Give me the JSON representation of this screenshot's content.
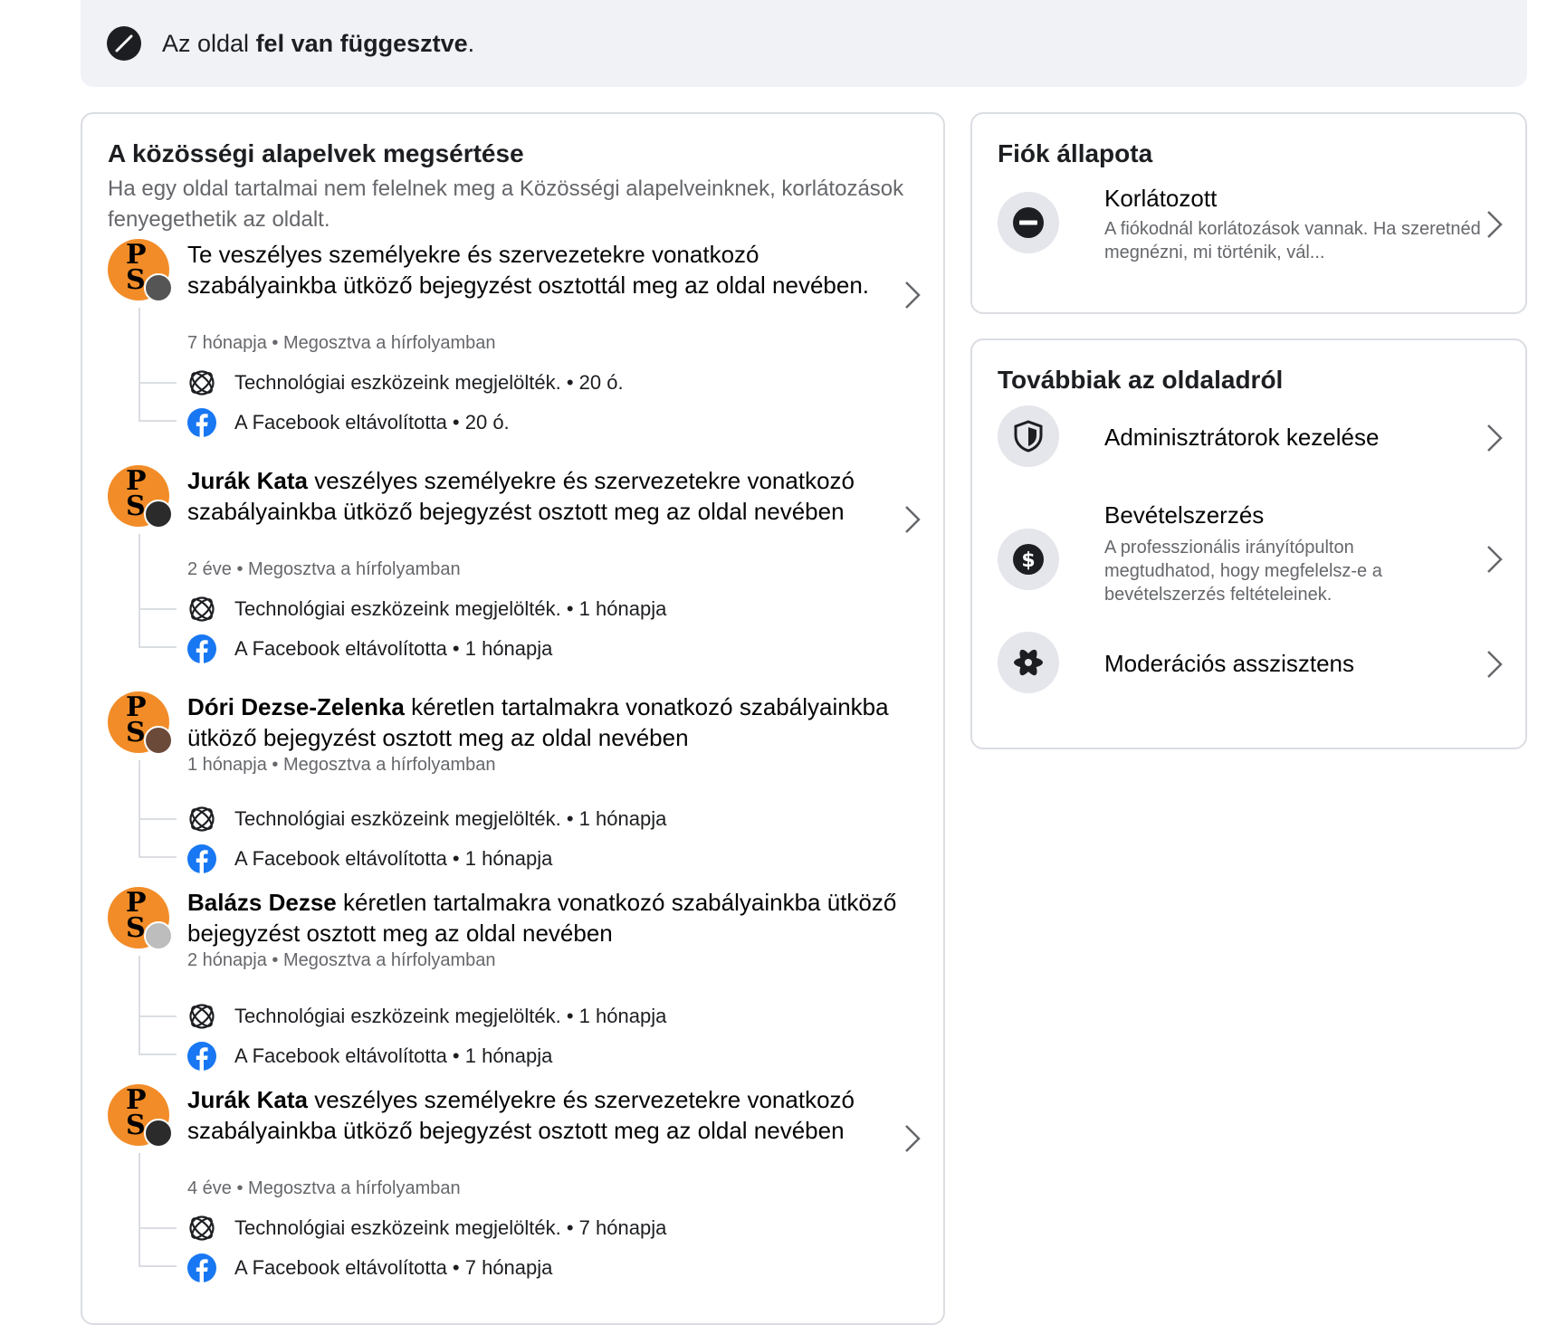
{
  "banner": {
    "text_pre": "Az oldal ",
    "text_bold": "fel van függesztve",
    "text_post": ".",
    "icon": "suspended-icon"
  },
  "violations_card": {
    "title": "A közösségi alapelvek megsértése",
    "subtitle": "Ha egy oldal tartalmai nem felelnek meg a Közösségi alapelveinknek, korlátozások fenyegethetik az oldalt.",
    "items": [
      {
        "author": "",
        "title_rest": "Te veszélyes személyekre és szervezetekre vonatkozó szabályainkba ütköző bejegyzést osztottál meg az oldal nevében.",
        "meta": "7 hónapja • Megosztva a hírfolyamban",
        "flagged": "Technológiai eszközeink megjelölték. • 20 ó.",
        "removed": "A Facebook eltávolította • 20 ó."
      },
      {
        "author": "Jurák Kata",
        "title_rest": " veszélyes személyekre és szervezetekre vonatkozó szabályainkba ütköző bejegyzést osztott meg az oldal nevében",
        "meta": "2 éve • Megosztva a hírfolyamban",
        "flagged": "Technológiai eszközeink megjelölték. • 1 hónapja",
        "removed": "A Facebook eltávolította • 1 hónapja"
      },
      {
        "author": "Dóri Dezse-Zelenka",
        "title_rest": " kéretlen tartalmakra vonatkozó szabályainkba ütköző bejegyzést osztott meg az oldal nevében",
        "meta": "1 hónapja • Megosztva a hírfolyamban",
        "flagged": "Technológiai eszközeink megjelölték. • 1 hónapja",
        "removed": "A Facebook eltávolította • 1 hónapja"
      },
      {
        "author": "Balázs Dezse",
        "title_rest": " kéretlen tartalmakra vonatkozó szabályainkba ütköző bejegyzést osztott meg az oldal nevében",
        "meta": "2 hónapja • Megosztva a hírfolyamban",
        "flagged": "Technológiai eszközeink megjelölték. • 1 hónapja",
        "removed": "A Facebook eltávolította • 1 hónapja"
      },
      {
        "author": "Jurák Kata",
        "title_rest": " veszélyes személyekre és szervezetekre vonatkozó szabályainkba ütköző bejegyzést osztott meg az oldal nevében",
        "meta": "4 éve • Megosztva a hírfolyamban",
        "flagged": "Technológiai eszközeink megjelölték. • 7 hónapja",
        "removed": "A Facebook eltávolította • 7 hónapja"
      }
    ],
    "avatar_letters": "P\nS"
  },
  "status_card": {
    "title": "Fiók állapota",
    "status_title": "Korlátozott",
    "status_desc": "A fiókodnál korlátozások vannak. Ha szeretnéd megnézni, mi történik, vál..."
  },
  "more_card": {
    "title": "Továbbiak az oldaladról",
    "admins": "Adminisztrátorok kezelése",
    "monetization_title": "Bevételszerzés",
    "monetization_desc": "A professzionális irányítópulton megtudhatod, hogy megfelelsz-e a bevételszerzés feltételeinek.",
    "moderation": "Moderációs asszisztens"
  },
  "colors": {
    "avatar_bg": "#f28c28",
    "facebook_blue": "#1877f2",
    "muted_text": "#65676b",
    "border": "#dadde1",
    "banner_bg": "#f0f2f5"
  }
}
